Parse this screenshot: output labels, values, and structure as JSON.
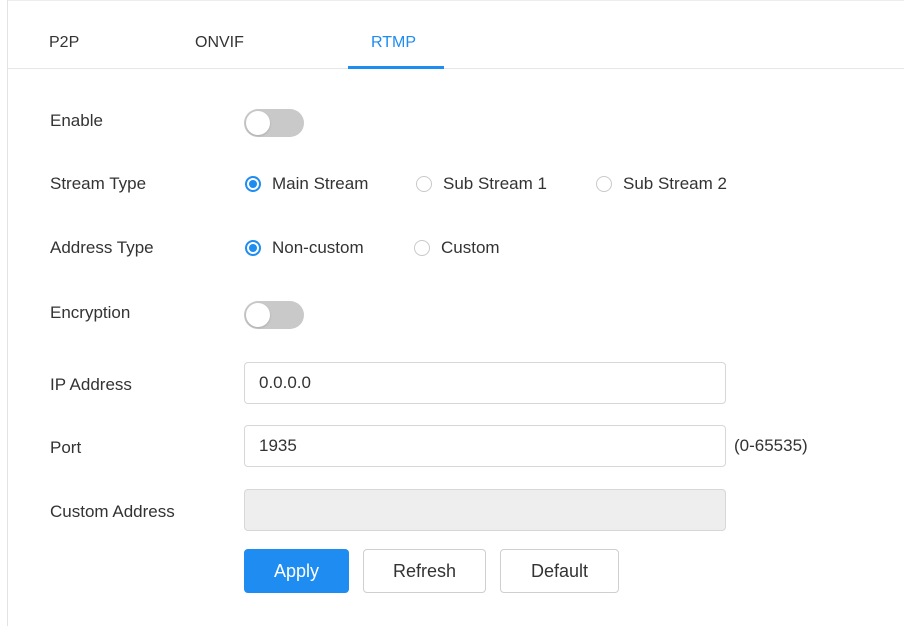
{
  "tabs": [
    {
      "label": "P2P",
      "active": false
    },
    {
      "label": "ONVIF",
      "active": false
    },
    {
      "label": "RTMP",
      "active": true
    }
  ],
  "accent_color": "#1e8cf0",
  "form": {
    "enable": {
      "label": "Enable",
      "on": false
    },
    "stream_type": {
      "label": "Stream Type",
      "options": [
        "Main Stream",
        "Sub Stream 1",
        "Sub Stream 2"
      ],
      "selected": "Main Stream"
    },
    "address_type": {
      "label": "Address Type",
      "options": [
        "Non-custom",
        "Custom"
      ],
      "selected": "Non-custom"
    },
    "encryption": {
      "label": "Encryption",
      "on": false
    },
    "ip_address": {
      "label": "IP Address",
      "value": "0.0.0.0"
    },
    "port": {
      "label": "Port",
      "value": "1935",
      "range_hint": "(0-65535)"
    },
    "custom_address": {
      "label": "Custom Address",
      "value": "",
      "disabled": true
    }
  },
  "buttons": {
    "apply": "Apply",
    "refresh": "Refresh",
    "default": "Default"
  }
}
